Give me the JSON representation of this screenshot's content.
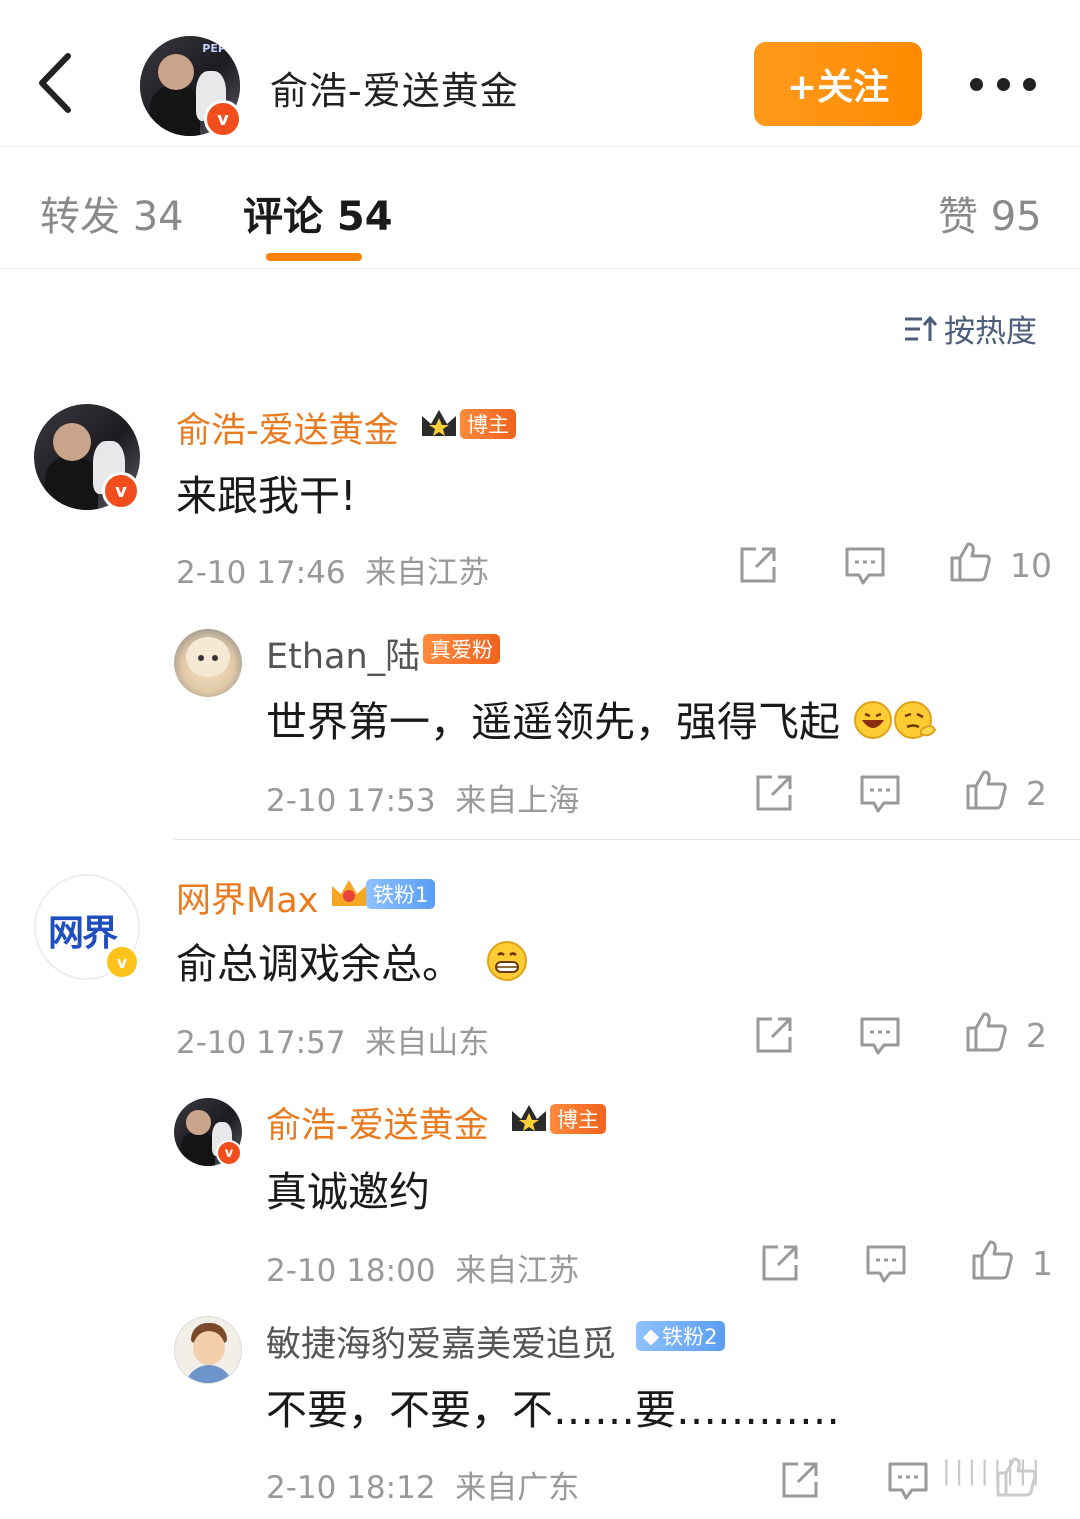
{
  "header": {
    "title": "俞浩-爱送黄金",
    "follow_label": "+关注",
    "avatar_sign_text": "PEPP"
  },
  "tabs": [
    {
      "label": "转发 34",
      "active": false
    },
    {
      "label": "评论 54",
      "active": true
    },
    {
      "label": "赞 95",
      "active": false
    }
  ],
  "sort": {
    "label": "按热度"
  },
  "comments": [
    {
      "user": "俞浩-爱送黄金",
      "badge": "博主",
      "text": "来跟我干!",
      "time": "2-10 17:46",
      "location": "来自江苏",
      "likes": "10",
      "replies": [
        {
          "user": "Ethan_陆",
          "badge": "真爱粉",
          "text": "世界第一，遥遥领先，强得飞起",
          "time": "2-10 17:53",
          "location": "来自上海",
          "likes": "2"
        }
      ]
    },
    {
      "user": "网界Max",
      "badge": "铁粉1",
      "avatar_text": "网界",
      "text": "俞总调戏余总。",
      "time": "2-10 17:57",
      "location": "来自山东",
      "likes": "2",
      "replies": [
        {
          "user": "俞浩-爱送黄金",
          "badge": "博主",
          "text": "真诚邀约",
          "time": "2-10 18:00",
          "location": "来自江苏",
          "likes": "1"
        },
        {
          "user": "敏捷海豹爱嘉美爱追觅",
          "badge": "铁粉2",
          "text": "不要，不要，不……要…………",
          "time": "2-10 18:12",
          "location": "来自广东",
          "likes": ""
        }
      ]
    }
  ],
  "colors": {
    "accent": "#ff8200",
    "username": "#ea7a1e",
    "meta": "#999999",
    "verified": "#f7a21b"
  },
  "icons": [
    "back-arrow-icon",
    "verified-v-icon",
    "more-dots-icon",
    "sort-icon",
    "share-icon",
    "comment-icon",
    "like-icon",
    "crown-icon",
    "diamond-icon"
  ]
}
